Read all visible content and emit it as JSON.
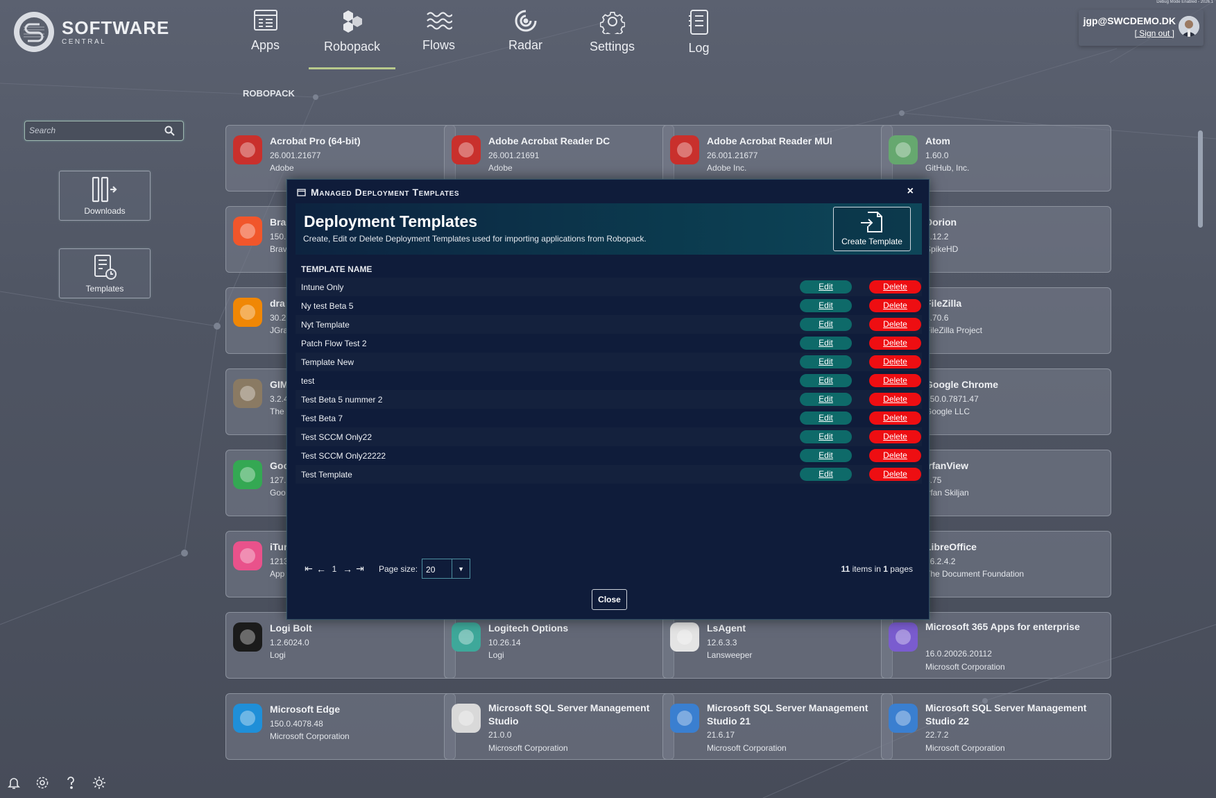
{
  "debug_text": "Debug Mode Enabled - 2026.1",
  "logo": {
    "title": "SOFTWARE",
    "subtitle": "CENTRAL"
  },
  "nav": [
    {
      "label": "Apps",
      "icon": "apps-icon"
    },
    {
      "label": "Robopack",
      "icon": "robopack-icon",
      "active": true
    },
    {
      "label": "Flows",
      "icon": "flows-icon"
    },
    {
      "label": "Radar",
      "icon": "radar-icon"
    },
    {
      "label": "Settings",
      "icon": "settings-gear-icon"
    },
    {
      "label": "Log",
      "icon": "log-icon"
    }
  ],
  "user": {
    "email": "jgp@SWCDEMO.DK",
    "signout": "[ Sign out ]"
  },
  "search": {
    "placeholder": "Search"
  },
  "sidebar": {
    "downloads": "Downloads",
    "templates": "Templates"
  },
  "breadcrumb": "ROBOPACK",
  "cards": [
    {
      "name": "Acrobat Pro (64-bit)",
      "version": "26.001.21677",
      "publisher": "Adobe",
      "icon": "acrobat-icon",
      "color": "#c9302c"
    },
    {
      "name": "Adobe Acrobat Reader DC",
      "version": "26.001.21691",
      "publisher": "Adobe",
      "icon": "acrobat-icon",
      "color": "#c9302c"
    },
    {
      "name": "Adobe Acrobat Reader MUI",
      "version": "26.001.21677",
      "publisher": "Adobe Inc.",
      "icon": "acrobat-icon",
      "color": "#c9302c"
    },
    {
      "name": "Atom",
      "version": "1.60.0",
      "publisher": "GitHub, Inc.",
      "icon": "atom-icon",
      "color": "#66a86f"
    },
    {
      "name": "Bra",
      "version": "150.",
      "publisher": "Brav",
      "icon": "brave-icon",
      "color": "#f1562b"
    },
    {
      "name": "",
      "version": "",
      "publisher": "",
      "icon": "",
      "color": ""
    },
    {
      "name": "",
      "version": "",
      "publisher": "",
      "icon": "",
      "color": ""
    },
    {
      "name": "Dorion",
      "version": "6.12.2",
      "publisher": "SpikeHD",
      "icon": "dorion-icon",
      "color": "#7d87c8"
    },
    {
      "name": "dra",
      "version": "30.2",
      "publisher": "JGra",
      "icon": "drawio-icon",
      "color": "#f08705"
    },
    {
      "name": "",
      "version": "",
      "publisher": "",
      "icon": "",
      "color": ""
    },
    {
      "name": "",
      "version": "",
      "publisher": "",
      "icon": "",
      "color": ""
    },
    {
      "name": "FileZilla",
      "version": "3.70.6",
      "publisher": "FileZilla Project",
      "icon": "filezilla-icon",
      "color": "#bf0000"
    },
    {
      "name": "GIM",
      "version": "3.2.4",
      "publisher": "The",
      "icon": "gimp-icon",
      "color": "#8a7a63"
    },
    {
      "name": "",
      "version": "",
      "publisher": "",
      "icon": "",
      "color": ""
    },
    {
      "name": "",
      "version": "",
      "publisher": "",
      "icon": "",
      "color": ""
    },
    {
      "name": "Google Chrome",
      "version": "150.0.7871.47",
      "publisher": "Google LLC",
      "icon": "chrome-icon",
      "color": "#4285f4"
    },
    {
      "name": "Goo",
      "version": "127.",
      "publisher": "Goo",
      "icon": "google-drive-icon",
      "color": "#34a853"
    },
    {
      "name": "",
      "version": "",
      "publisher": "",
      "icon": "",
      "color": ""
    },
    {
      "name": "",
      "version": "",
      "publisher": "",
      "icon": "",
      "color": ""
    },
    {
      "name": "IrfanView",
      "version": "4.75",
      "publisher": "Irfan Skiljan",
      "icon": "irfanview-icon",
      "color": "#c0392b"
    },
    {
      "name": "iTur",
      "version": "1213",
      "publisher": "App",
      "icon": "itunes-icon",
      "color": "#e9528b"
    },
    {
      "name": "",
      "version": "",
      "publisher": "",
      "icon": "",
      "color": ""
    },
    {
      "name": "",
      "version": "",
      "publisher": "",
      "icon": "",
      "color": ""
    },
    {
      "name": "LibreOffice",
      "version": "26.2.4.2",
      "publisher": "The Document Foundation",
      "icon": "libreoffice-icon",
      "color": "#e7e7e7"
    },
    {
      "name": "Logi Bolt",
      "version": "1.2.6024.0",
      "publisher": "Logi",
      "icon": "logi-bolt-icon",
      "color": "#1b1b1b"
    },
    {
      "name": "Logitech Options",
      "version": "10.26.14",
      "publisher": "Logi",
      "icon": "logitech-options-icon",
      "color": "#3ea89a"
    },
    {
      "name": "LsAgent",
      "version": "12.6.3.3",
      "publisher": "Lansweeper",
      "icon": "lsagent-icon",
      "color": "#e4e4e4"
    },
    {
      "name": "Microsoft 365 Apps for enterprise",
      "version": "16.0.20026.20112",
      "publisher": "Microsoft Corporation",
      "icon": "m365-icon",
      "color": "#7a5ccf"
    },
    {
      "name": "Microsoft Edge",
      "version": "150.0.4078.48",
      "publisher": "Microsoft Corporation",
      "icon": "edge-icon",
      "color": "#1f8fd8"
    },
    {
      "name": "Microsoft SQL Server Management Studio",
      "version": "21.0.0",
      "publisher": "Microsoft Corporation",
      "icon": "ssms-tools-icon",
      "color": "#d9d9d9"
    },
    {
      "name": "Microsoft SQL Server Management Studio 21",
      "version": "21.6.17",
      "publisher": "Microsoft Corporation",
      "icon": "ssms-icon",
      "color": "#3a7fd0"
    },
    {
      "name": "Microsoft SQL Server Management Studio 22",
      "version": "22.7.2",
      "publisher": "Microsoft Corporation",
      "icon": "ssms-icon",
      "color": "#3a7fd0"
    }
  ],
  "modal": {
    "title": "Managed Deployment Templates",
    "heading": "Deployment Templates",
    "description": "Create, Edit or Delete Deployment Templates used for importing applications from Robopack.",
    "create_label": "Create Template",
    "column_header": "TEMPLATE NAME",
    "edit_label": "Edit",
    "delete_label": "Delete",
    "templates": [
      "Intune Only",
      "Ny test Beta 5",
      "Nyt Template",
      "Patch Flow Test 2",
      "Template New",
      "test",
      "Test Beta 5 nummer 2",
      "Test Beta 7",
      "Test SCCM Only22",
      "Test SCCM Only22222",
      "Test Template"
    ],
    "pager": {
      "page": "1",
      "page_size_label": "Page size:",
      "page_size": "20",
      "items": "11",
      "items_label": "items in",
      "pages": "1",
      "pages_label": "pages"
    },
    "close_label": "Close",
    "close_x": "×"
  }
}
